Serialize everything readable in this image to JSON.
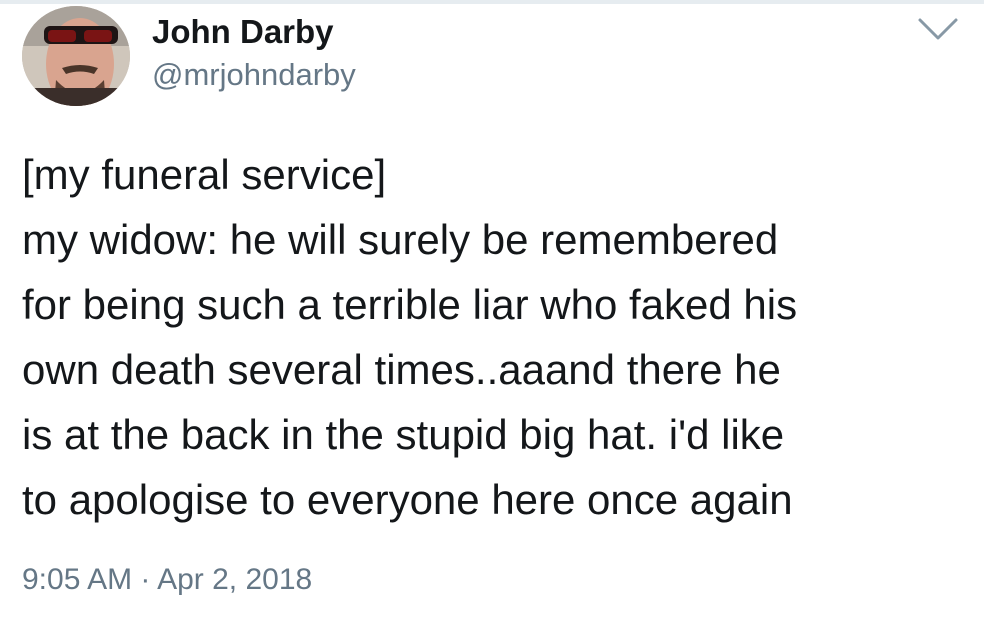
{
  "tweet": {
    "author": {
      "display_name": "John Darby",
      "handle": "@mrjohndarby",
      "avatar_icon": "profile-photo-avatar"
    },
    "menu_icon": "chevron-down-icon",
    "text_lines": [
      "[my funeral service]",
      "my widow: he will surely be remembered",
      "for being such a terrible liar who faked his",
      "own death several times..aaand there he",
      "is at the back in the stupid big hat. i'd like",
      "to apologise to everyone here once again"
    ],
    "timestamp": "9:05 AM · Apr 2, 2018"
  },
  "colors": {
    "text_primary": "#14171a",
    "text_secondary": "#657786",
    "caret": "#8899a6",
    "background": "#ffffff"
  }
}
